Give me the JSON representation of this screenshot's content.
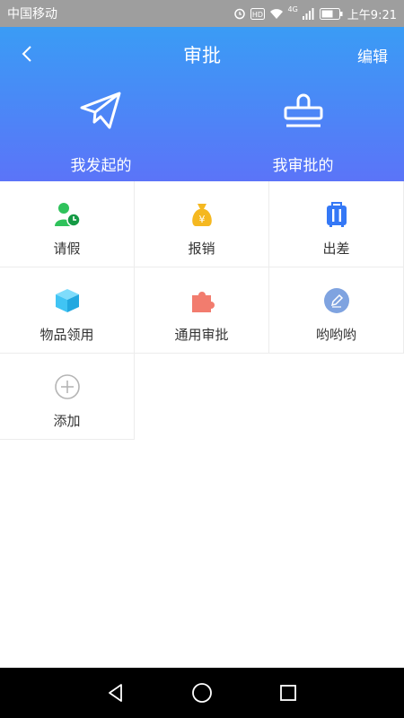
{
  "status_bar": {
    "carrier": "中国移动",
    "network": "4G",
    "time": "上午9:21",
    "icons": [
      "alarm-icon",
      "hd-icon",
      "wifi-icon",
      "signal-icon",
      "battery-icon"
    ]
  },
  "header": {
    "title": "审批",
    "back_icon": "chevron-left-icon",
    "edit_label": "编辑",
    "colors": {
      "gradient_top": "#3a9cf5",
      "gradient_bottom": "#5b74f8"
    }
  },
  "hero": {
    "items": [
      {
        "label": "我发起的",
        "icon": "paper-plane-icon"
      },
      {
        "label": "我审批的",
        "icon": "stamp-icon"
      }
    ]
  },
  "grid": {
    "items": [
      {
        "label": "请假",
        "icon": "person-clock-icon",
        "color": "#2fc25b"
      },
      {
        "label": "报销",
        "icon": "money-bag-icon",
        "color": "#f5b820"
      },
      {
        "label": "出差",
        "icon": "suitcase-icon",
        "color": "#3478f6"
      },
      {
        "label": "物品领用",
        "icon": "box-icon",
        "color": "#40c4f4"
      },
      {
        "label": "通用审批",
        "icon": "puzzle-icon",
        "color": "#f27c6e"
      },
      {
        "label": "哟哟哟",
        "icon": "pencil-circle-icon",
        "color": "#7fa3e0"
      },
      {
        "label": "添加",
        "icon": "add-circle-icon",
        "color": "#b5b5b5"
      }
    ]
  },
  "system_nav": [
    "back-triangle-icon",
    "home-circle-icon",
    "recents-square-icon"
  ]
}
